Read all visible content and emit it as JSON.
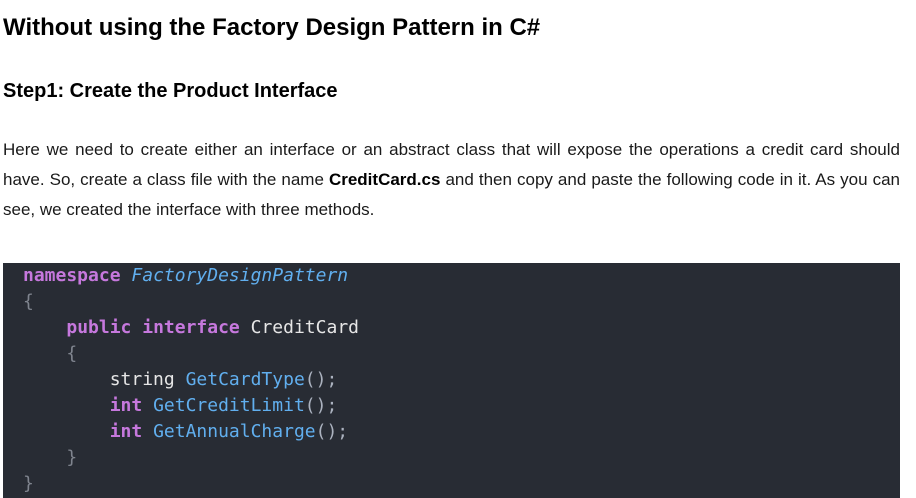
{
  "heading_main": "Without using the Factory Design Pattern in C#",
  "heading_step": "Step1: Create the Product Interface",
  "paragraph": {
    "part1": "Here we need to create either an interface or an abstract class that will expose the operations a credit card should have. So, create a class file with the name ",
    "filename": "CreditCard.cs",
    "part2": " and then copy and paste the following code in it. As you can see, we created the interface with three methods."
  },
  "code": {
    "kw_namespace": "namespace",
    "namespace_name": "FactoryDesignPattern",
    "open_brace": "{",
    "close_brace": "}",
    "kw_public": "public",
    "kw_interface": "interface",
    "interface_name": "CreditCard",
    "methods": [
      {
        "return_type": "string",
        "name": "GetCardType",
        "suffix": "();"
      },
      {
        "return_type": "int",
        "name": "GetCreditLimit",
        "suffix": "();"
      },
      {
        "return_type": "int",
        "name": "GetAnnualCharge",
        "suffix": "();"
      }
    ]
  }
}
